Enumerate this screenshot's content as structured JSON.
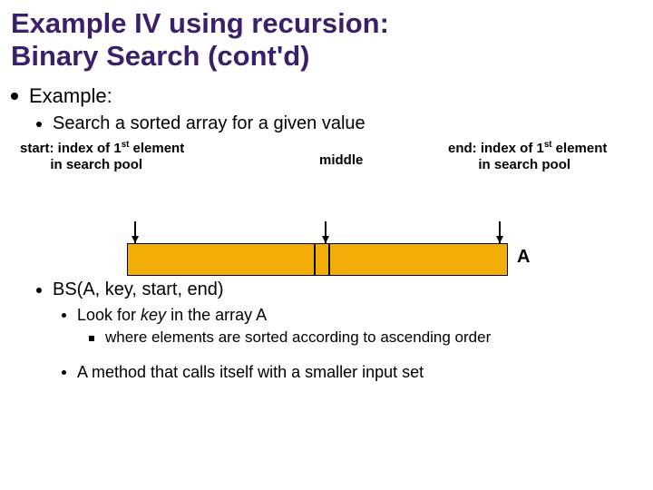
{
  "title_line1": "Example IV using recursion:",
  "title_line2": "Binary Search (cont'd)",
  "b1": "Example:",
  "b2": "Search a sorted array for a given value",
  "start_label_line1": "start: index of 1",
  "start_label_sup": "st",
  "start_label_line1b": " element",
  "start_label_line2": "in search pool",
  "middle_label": "middle",
  "end_label_line1": "end: index of 1",
  "end_label_sup": "st",
  "end_label_line1b": " element",
  "end_label_line2": "in search pool",
  "array_label": "A",
  "b3": "BS(A, key, start, end)",
  "b4a_pre": "Look for ",
  "b4a_italic": "key",
  "b4a_post": " in the array A",
  "b4a_sub": "where elements are sorted according to ascending order",
  "b4b": "A method that calls itself with a smaller input set"
}
